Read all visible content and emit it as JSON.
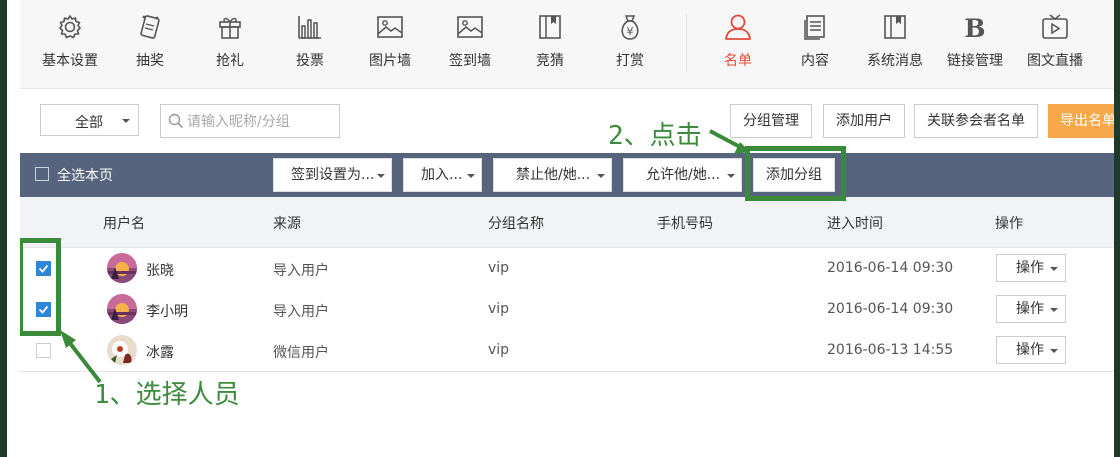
{
  "nav": {
    "items": [
      {
        "label": "基本设置",
        "icon": "gear-icon"
      },
      {
        "label": "抽奖",
        "icon": "lottery-icon"
      },
      {
        "label": "抢礼",
        "icon": "gift-icon"
      },
      {
        "label": "投票",
        "icon": "bar-chart-icon"
      },
      {
        "label": "图片墙",
        "icon": "image-icon"
      },
      {
        "label": "签到墙",
        "icon": "image-icon"
      },
      {
        "label": "竞猜",
        "icon": "bookmark-icon"
      },
      {
        "label": "打赏",
        "icon": "money-bag-icon"
      },
      {
        "label": "名单",
        "icon": "user-icon",
        "active": true
      },
      {
        "label": "内容",
        "icon": "document-icon"
      },
      {
        "label": "系统消息",
        "icon": "bookmark-icon"
      },
      {
        "label": "链接管理",
        "icon": "bold-b-icon"
      },
      {
        "label": "图文直播",
        "icon": "tv-play-icon"
      }
    ],
    "active_color": "#e24b3b"
  },
  "toolbar": {
    "filter_value": "全部",
    "search_placeholder": "请输入昵称/分组",
    "buttons": [
      "分组管理",
      "添加用户",
      "关联参会者名单",
      "导出名单"
    ]
  },
  "bulk_bar": {
    "select_page_label": "全选本页",
    "dropdowns": [
      "签到设置为...",
      "加入...",
      "禁止他/她...",
      "允许他/她..."
    ],
    "add_group_label": "添加分组",
    "bar_color": "#56657d"
  },
  "table": {
    "headers": [
      "用户名",
      "来源",
      "分组名称",
      "手机号码",
      "进入时间",
      "操作"
    ],
    "rows": [
      {
        "checked": true,
        "name": "张晓",
        "source": "导入用户",
        "group": "vip",
        "phone": "",
        "time": "2016-06-14 09:30",
        "action": "操作",
        "avatar": "sunset-avatar"
      },
      {
        "checked": true,
        "name": "李小明",
        "source": "导入用户",
        "group": "vip",
        "phone": "",
        "time": "2016-06-14 09:30",
        "action": "操作",
        "avatar": "sunset-avatar"
      },
      {
        "checked": false,
        "name": "冰露",
        "source": "微信用户",
        "group": "vip",
        "phone": "",
        "time": "2016-06-13 14:55",
        "action": "操作",
        "avatar": "flower-avatar"
      }
    ]
  },
  "annotations": {
    "step1": "1、选择人员",
    "step2": "2、点击",
    "color": "#3a8a3a"
  }
}
